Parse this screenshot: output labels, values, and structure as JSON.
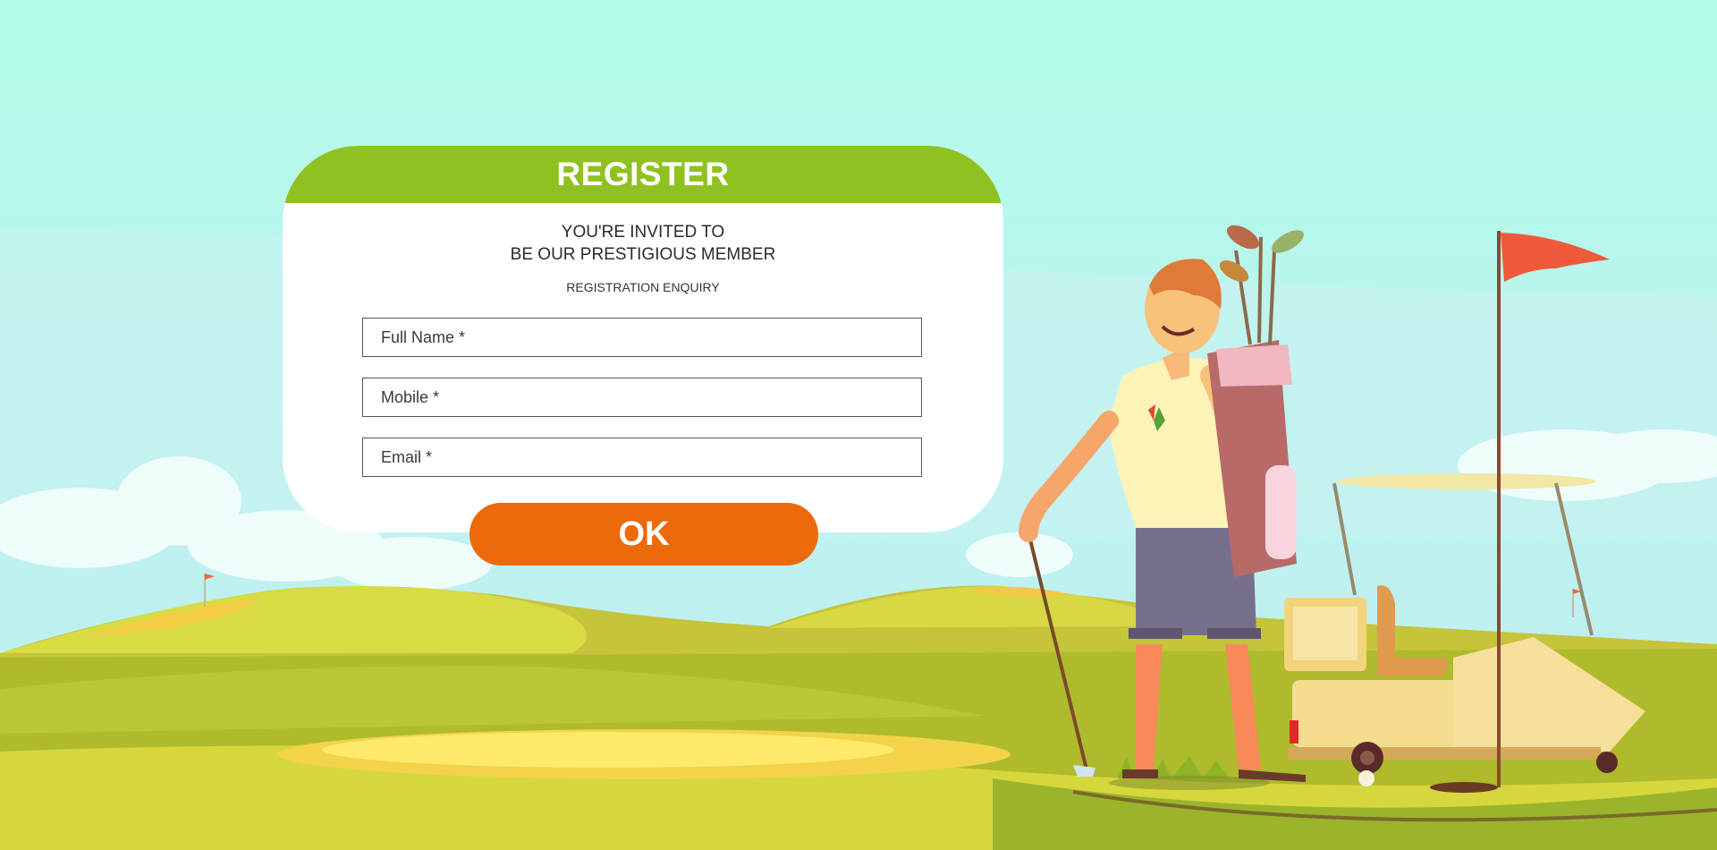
{
  "form": {
    "title": "REGISTER",
    "invite_line1": "YOU'RE INVITED TO",
    "invite_line2": "BE OUR PRESTIGIOUS MEMBER",
    "subtitle": "REGISTRATION ENQUIRY",
    "full_name_placeholder": "Full Name *",
    "mobile_placeholder": "Mobile *",
    "email_placeholder": "Email *",
    "submit_label": "OK"
  },
  "colors": {
    "header_green": "#90c122",
    "button_orange": "#ec6a0b",
    "sky": "#b6f5e6",
    "flag_red": "#ef5a3c"
  }
}
